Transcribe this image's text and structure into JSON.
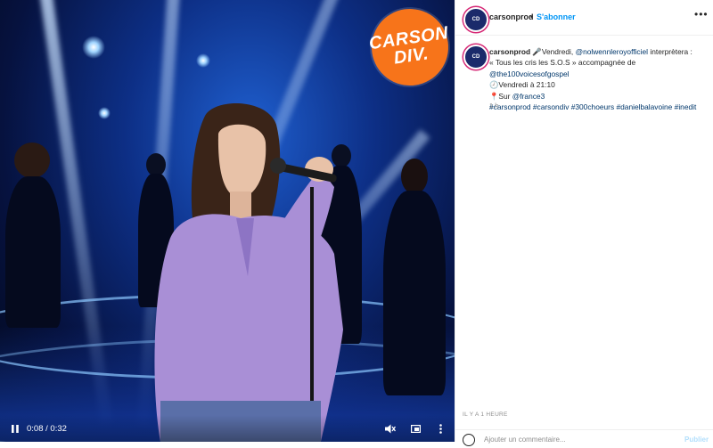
{
  "video": {
    "logo_line1": "CARSON",
    "logo_line2": "DIV.",
    "current_time": "0:08",
    "duration": "0:32",
    "time_display": "0:08 / 0:32",
    "icons": {
      "play_pause": "pause-icon",
      "mute": "muted-speaker-icon",
      "fullscreen": "fullscreen-icon",
      "menu": "more-vertical-icon"
    }
  },
  "post": {
    "header": {
      "username": "carsonprod",
      "separator": "•",
      "follow_label": "S'abonner",
      "avatar_text": "CARSON DIV.",
      "more_icon": "more-horizontal-icon"
    },
    "caption": {
      "username": "carsonprod",
      "line1_a": "🎤Vendredi, ",
      "mention1": "@nolwennleroyofficiel",
      "line1_b": " interprètera :",
      "line2_a": "« Tous les cris les S.O.S » accompagnée de ",
      "mention2": "@the100voicesofgospel",
      "line3": "🕗Vendredi à 21:10",
      "line4_a": "📍Sur ",
      "mention3": "@france3",
      "hashtags": "#carsonprod #carsondiv #300choeurs #danielbalavoine #inedit"
    },
    "caption_time": "1 h",
    "timestamp": "IL Y A 1 HEURE",
    "comment_placeholder": "Ajouter un commentaire...",
    "publish_label": "Publier"
  },
  "colors": {
    "accent": "#0095f6",
    "logo_orange": "#f7741a",
    "link": "#00376b",
    "muted": "#8e8e8e"
  }
}
